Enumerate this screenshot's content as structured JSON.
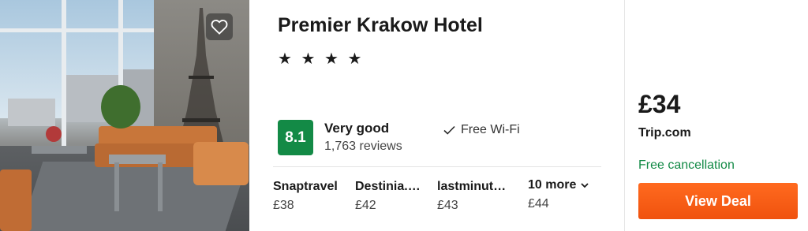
{
  "hotel": {
    "name": "Premier Krakow Hotel",
    "stars_text": "★ ★ ★ ★",
    "star_count": 4,
    "favorite_icon": "heart-icon"
  },
  "rating": {
    "score": "8.1",
    "label": "Very good",
    "reviews": "1,763 reviews",
    "color": "#138a46"
  },
  "amenities": [
    {
      "icon": "check-icon",
      "label": "Free Wi-Fi"
    }
  ],
  "offers": [
    {
      "site": "Snaptravel",
      "price": "£38"
    },
    {
      "site": "Destinia.…",
      "price": "£42"
    },
    {
      "site": "lastminut…",
      "price": "£43"
    }
  ],
  "more_offers": {
    "label": "10 more",
    "price": "£44",
    "icon": "chevron-down-icon"
  },
  "deal": {
    "price": "£34",
    "site": "Trip.com",
    "cancellation": "Free cancellation",
    "button_label": "View Deal",
    "button_color": "#f0520e",
    "cancellation_color": "#138a46"
  }
}
